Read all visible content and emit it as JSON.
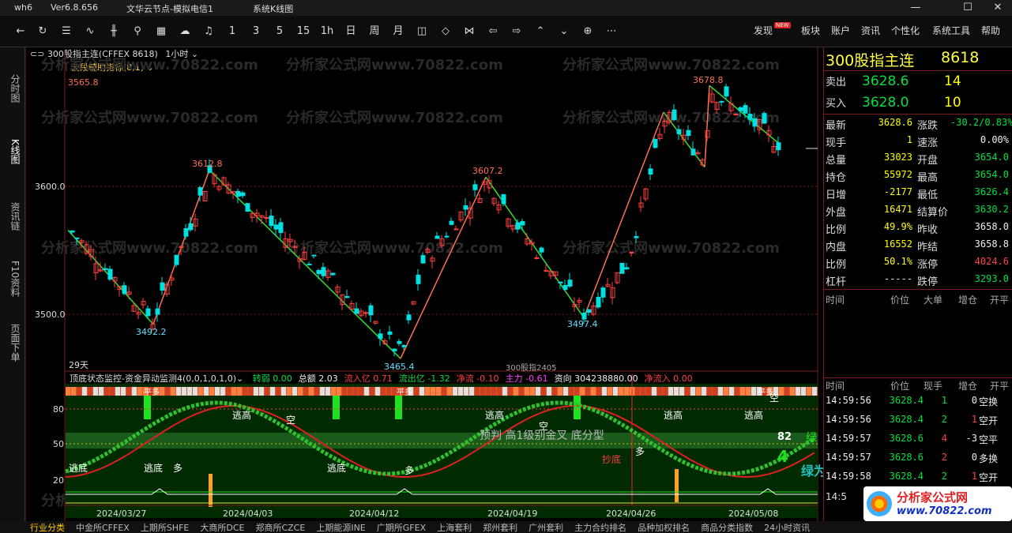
{
  "titlebar": {
    "app": "wh6",
    "version": "Ver6.8.656",
    "server": "文华云节点-模拟电信1",
    "system": "系统K线图"
  },
  "toolbar": {
    "icons": [
      "back-icon",
      "refresh-icon",
      "list-icon",
      "line-chart-icon",
      "kline-icon",
      "tick-icon",
      "quote-board-icon",
      "cloud-icon",
      "bell-icon"
    ],
    "periods": [
      "1",
      "3",
      "5",
      "15",
      "1h",
      "日",
      "周",
      "月"
    ],
    "menu": [
      "发现",
      "板块",
      "账户",
      "资讯",
      "个性化",
      "系统工具",
      "帮助"
    ],
    "new_badge": "NEW"
  },
  "left_tabs": [
    "分时图",
    "K线图",
    "资讯链",
    "F10资料",
    "页面下单"
  ],
  "chart": {
    "symbol_label": "300股指主连(CFFEX 8618)",
    "period": "1小时",
    "indicator": "波段辅助指标(8,1)",
    "price_ticks": [
      "3600.0",
      "3500.0"
    ],
    "peaks": [
      "3565.8",
      "3612.8",
      "3492.2",
      "3607.2",
      "3465.4",
      "3497.4",
      "3678.8"
    ],
    "day_count": "29天",
    "contract_note": "300股指2405",
    "watermark": "分析家公式网www.70822.com",
    "sub": {
      "title": "顶底状态监控-资金异动监测4(0,0,1,0,1,0)",
      "items": [
        {
          "label": "转弱",
          "value": "0.00",
          "color": "#00e040"
        },
        {
          "label": "总额",
          "value": "2.03",
          "color": "#eee"
        },
        {
          "label": "流入亿",
          "value": "0.71",
          "color": "#ff4040"
        },
        {
          "label": "流出亿",
          "value": "-1.32",
          "color": "#00e040"
        },
        {
          "label": "净流",
          "value": "-0.10",
          "color": "#ff4040"
        },
        {
          "label": "主力",
          "value": "-0.61",
          "color": "#ff40ff"
        },
        {
          "label": "资向",
          "value": "304238880.00",
          "color": "#eee"
        },
        {
          "label": "净流入",
          "value": "0.00",
          "color": "#ff4040"
        }
      ],
      "y_ticks": [
        "80",
        "50",
        "20"
      ],
      "labels": [
        "平多",
        "平多",
        "平多",
        "逃高",
        "逃高",
        "逃高",
        "逃高",
        "空",
        "空",
        "空",
        "逃底",
        "逃底",
        "逃底",
        "预判 高1级别金叉 底分型",
        "抄底",
        "多",
        "多",
        "多"
      ],
      "value_82": "82",
      "value_4": "4",
      "green_text": "绿",
      "green_text2": "绿为"
    },
    "dates": [
      "2024/03/27",
      "2024/04/03",
      "2024/04/12",
      "2024/04/19",
      "2024/04/26",
      "2024/05/08"
    ]
  },
  "quote": {
    "name": "300股指主连",
    "code": "8618",
    "ask_label": "卖出",
    "ask": "3628.6",
    "ask_vol": "14",
    "bid_label": "买入",
    "bid": "3628.0",
    "bid_vol": "10",
    "rows": [
      {
        "l1": "最新",
        "v1": "3628.6",
        "c1": "yel",
        "l2": "涨跌",
        "v2": "-30.2/0.83%",
        "c2": "grn"
      },
      {
        "l1": "现手",
        "v1": "1",
        "c1": "yel",
        "l2": "速涨",
        "v2": "0.00%",
        "c2": "wht"
      },
      {
        "l1": "总量",
        "v1": "33023",
        "c1": "yel",
        "l2": "开盘",
        "v2": "3654.0",
        "c2": "grn"
      },
      {
        "l1": "持仓",
        "v1": "55972",
        "c1": "yel",
        "l2": "最高",
        "v2": "3654.0",
        "c2": "grn"
      },
      {
        "l1": "日增",
        "v1": "-2177",
        "c1": "yel",
        "l2": "最低",
        "v2": "3626.4",
        "c2": "grn"
      },
      {
        "l1": "外盘",
        "v1": "16471",
        "c1": "yel",
        "l2": "结算价",
        "v2": "3630.2",
        "c2": "grn"
      },
      {
        "l1": "比例",
        "v1": "49.9%",
        "c1": "yel",
        "l2": "昨收",
        "v2": "3658.0",
        "c2": "wht"
      },
      {
        "l1": "内盘",
        "v1": "16552",
        "c1": "yel",
        "l2": "昨结",
        "v2": "3658.8",
        "c2": "wht"
      },
      {
        "l1": "比例",
        "v1": "50.1%",
        "c1": "yel",
        "l2": "涨停",
        "v2": "4024.6",
        "c2": "red"
      },
      {
        "l1": "杠杆",
        "v1": "-----",
        "c1": "wht",
        "l2": "跌停",
        "v2": "3293.0",
        "c2": "grn"
      }
    ],
    "ticks_header": [
      "时间",
      "价位",
      "大单",
      "增仓",
      "开平"
    ],
    "trades_header": [
      "时间",
      "价位",
      "现手",
      "增仓",
      "开平"
    ],
    "trades": [
      {
        "t": "14:59:56",
        "p": "3628.4",
        "v": "1",
        "oi": "0",
        "type": "空换",
        "vc": "grn",
        "oic": "wht",
        "tc": "wht"
      },
      {
        "t": "14:59:56",
        "p": "3628.4",
        "v": "2",
        "oi": "1",
        "type": "空开",
        "vc": "grn",
        "oic": "red",
        "tc": "wht"
      },
      {
        "t": "14:59:57",
        "p": "3628.6",
        "v": "4",
        "oi": "-3",
        "type": "空平",
        "vc": "red",
        "oic": "wht",
        "tc": "wht"
      },
      {
        "t": "14:59:57",
        "p": "3628.6",
        "v": "2",
        "oi": "0",
        "type": "多换",
        "vc": "red",
        "oic": "wht",
        "tc": "wht"
      },
      {
        "t": "14:59:58",
        "p": "3628.4",
        "v": "2",
        "oi": "1",
        "type": "空开",
        "vc": "grn",
        "oic": "red",
        "tc": "wht"
      }
    ],
    "last_time": "14:5"
  },
  "brand": {
    "name": "分析家公式网",
    "url": "www.70822.com"
  },
  "bottombar": [
    "行业分类",
    "中金所CFFEX",
    "上期所SHFE",
    "大商所DCE",
    "郑商所CZCE",
    "上期能源INE",
    "广期所GFEX",
    "上海套利",
    "郑州套利",
    "广州套利",
    "主力合约排名",
    "品种加权排名",
    "商品分类指数",
    "24小时资讯"
  ]
}
